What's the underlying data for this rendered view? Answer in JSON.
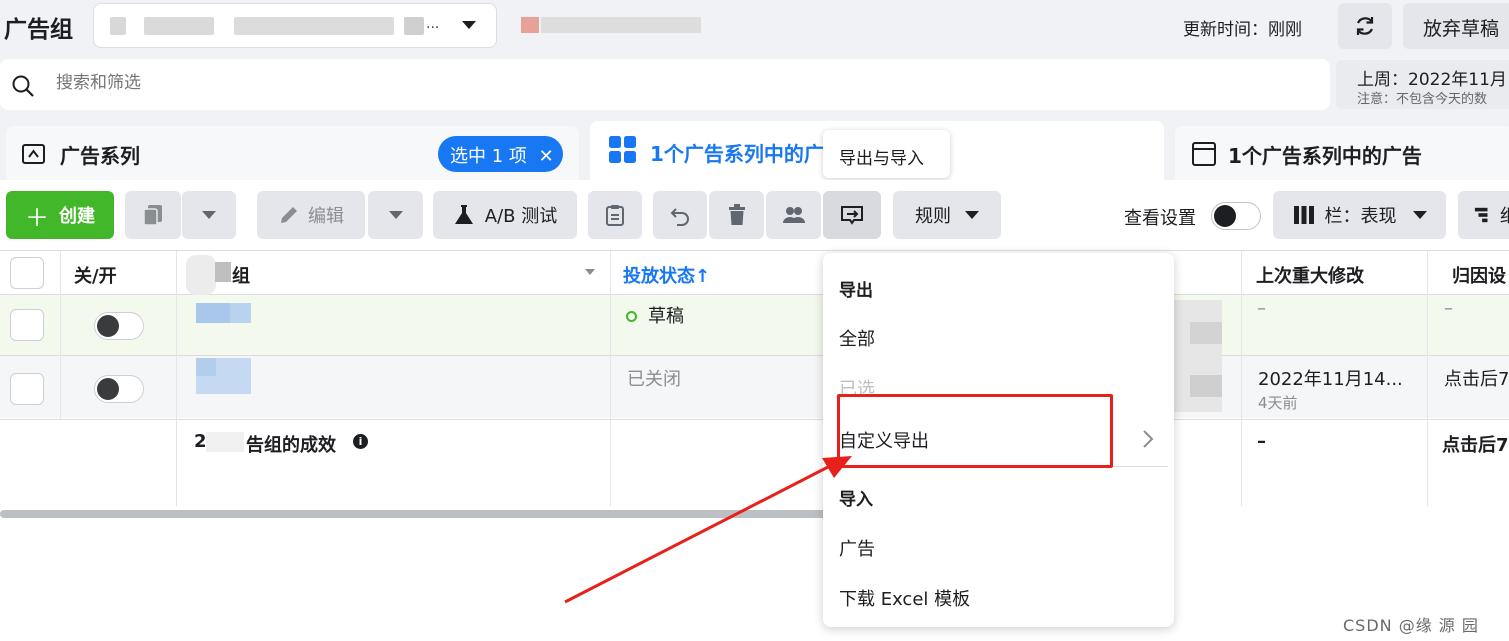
{
  "header": {
    "title": "广告组",
    "selector_ellipsis": "...",
    "update_time": "更新时间：刚刚",
    "discard_label": "放弃草稿"
  },
  "search": {
    "placeholder": "搜索和筛选"
  },
  "date_range": {
    "main": "上周：2022年11月",
    "note": "注意：不包含今天的数"
  },
  "tabs": {
    "campaigns": "广告系列",
    "selected_badge": "选中 1 项",
    "adsets": "1个广告系列中的广",
    "ads": "1个广告系列中的广告"
  },
  "tooltip": "导出与导入",
  "toolbar": {
    "create": "创建",
    "edit": "编辑",
    "ab_test": "A/B 测试",
    "rules": "规则",
    "view_settings": "查看设置",
    "columns": "栏：表现",
    "breakdown_partial": "细"
  },
  "table": {
    "headers": {
      "onoff": "关/开",
      "name": "组",
      "status": "投放状态↑",
      "last_edit": "上次重大修改",
      "attribution": "归因设"
    },
    "rows": [
      {
        "status": "草稿",
        "last_edit": "–",
        "attribution": "–"
      },
      {
        "status": "已关闭",
        "last_edit": "2022年11月14...",
        "last_edit_sub": "4天前",
        "attribution": "点击后7"
      }
    ],
    "summary": {
      "label_prefix": "2",
      "label": "告组的成效",
      "last_edit": "–",
      "attribution": "点击后7"
    }
  },
  "menu": {
    "export_heading": "导出",
    "export_all": "全部",
    "export_selected": "已选",
    "custom_export": "自定义导出",
    "import_heading": "导入",
    "import_ads": "广告",
    "download_template": "下载 Excel 模板"
  },
  "watermark": "CSDN @缘  源  园",
  "colors": {
    "accent": "#1877f2",
    "create_green": "#42b72a",
    "highlight_red": "#e8201b",
    "draft_row_bg": "#f3f9ec"
  }
}
